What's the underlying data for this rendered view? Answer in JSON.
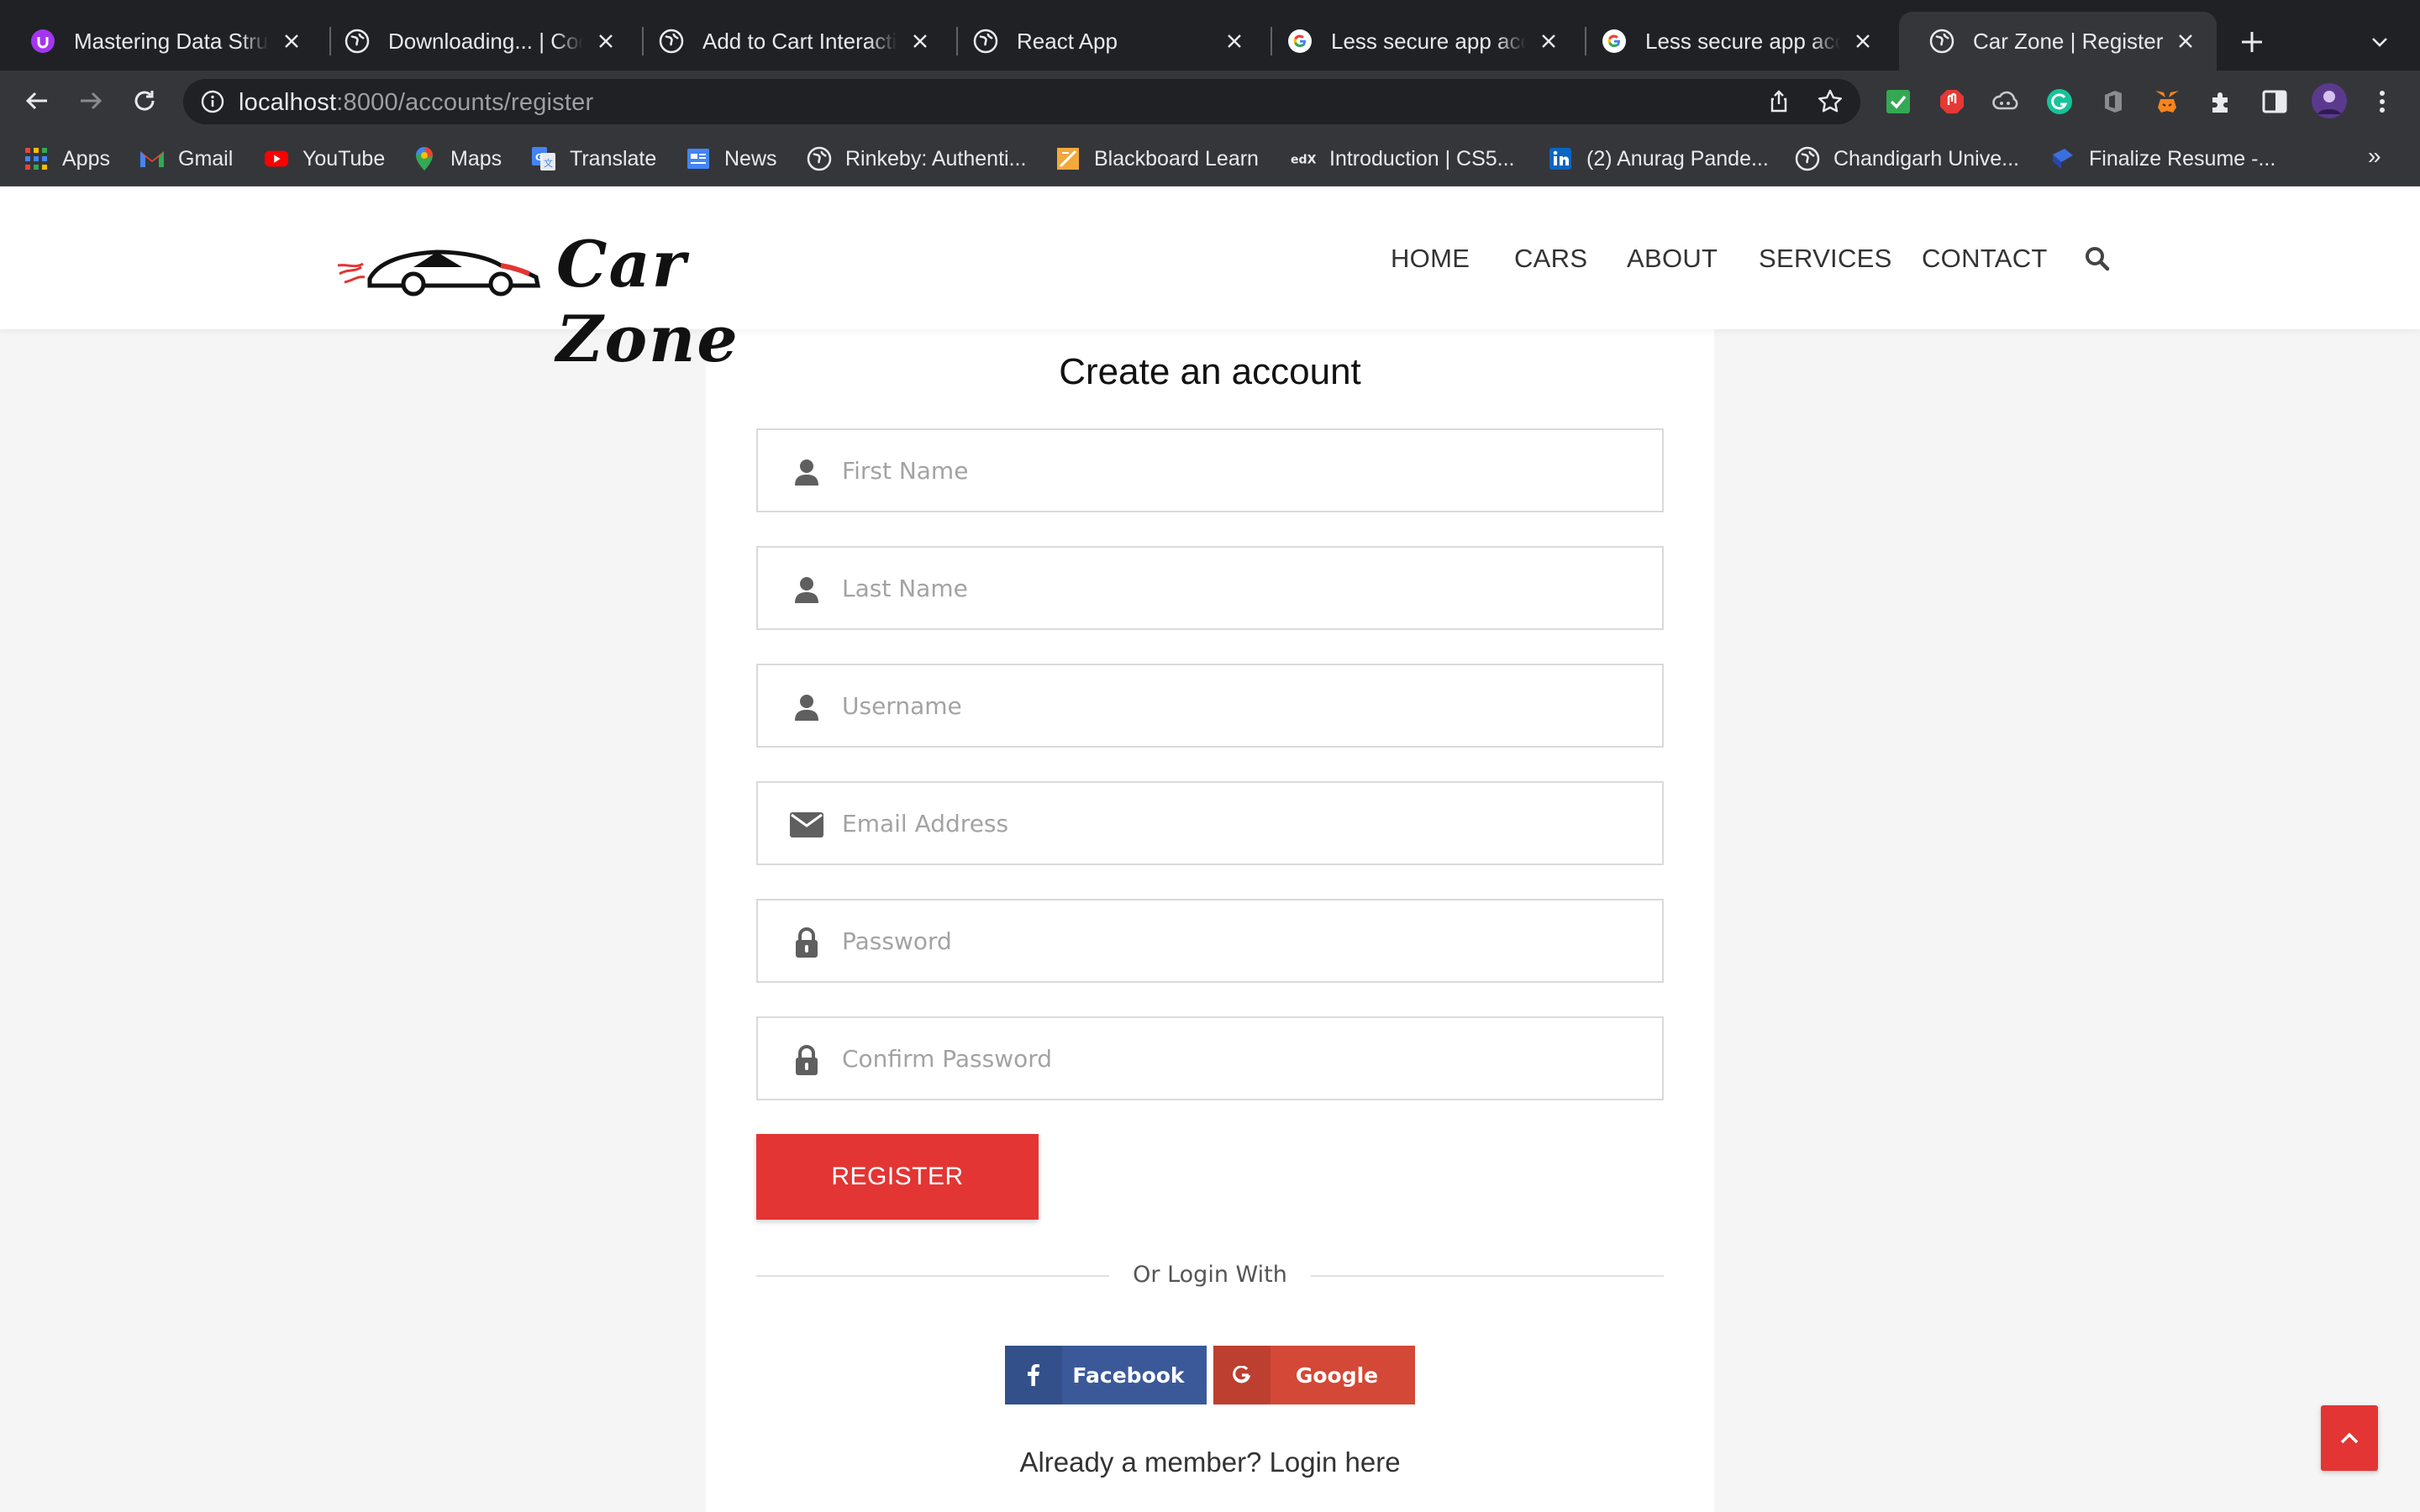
{
  "browser": {
    "tabs": [
      {
        "title": "Mastering Data Structures",
        "icon": "udemy-icon"
      },
      {
        "title": "Downloading... | Cody",
        "icon": "globe-icon"
      },
      {
        "title": "Add to Cart Interaction",
        "icon": "globe-icon"
      },
      {
        "title": "React App",
        "icon": "globe-icon"
      },
      {
        "title": "Less secure app access",
        "icon": "google-icon"
      },
      {
        "title": "Less secure app access",
        "icon": "google-icon"
      },
      {
        "title": "Car Zone | Register",
        "icon": "globe-icon",
        "active": true
      }
    ],
    "url_host": "localhost",
    "url_path": ":8000/accounts/register",
    "bookmarks": [
      {
        "label": "Apps",
        "icon": "apps-grid-icon"
      },
      {
        "label": "Gmail",
        "icon": "gmail-icon"
      },
      {
        "label": "YouTube",
        "icon": "youtube-icon"
      },
      {
        "label": "Maps",
        "icon": "maps-icon"
      },
      {
        "label": "Translate",
        "icon": "translate-icon"
      },
      {
        "label": "News",
        "icon": "news-icon"
      },
      {
        "label": "Rinkeby: Authenti...",
        "icon": "globe-icon"
      },
      {
        "label": "Blackboard Learn",
        "icon": "blackboard-icon"
      },
      {
        "label": "Introduction | CS5...",
        "icon": "edx-icon"
      },
      {
        "label": "(2) Anurag Pande...",
        "icon": "linkedin-icon"
      },
      {
        "label": "Chandigarh Unive...",
        "icon": "globe-icon"
      },
      {
        "label": "Finalize Resume -...",
        "icon": "resume-icon"
      }
    ],
    "bookmarks_overflow": "»"
  },
  "site": {
    "brand": "Car Zone",
    "nav": [
      "HOME",
      "CARS",
      "ABOUT",
      "SERVICES",
      "CONTACT"
    ],
    "accent_color": "#e23534"
  },
  "form": {
    "title": "Create an account",
    "fields": [
      {
        "placeholder": "First Name",
        "value": "",
        "icon": "user-icon"
      },
      {
        "placeholder": "Last Name",
        "value": "",
        "icon": "user-icon"
      },
      {
        "placeholder": "Username",
        "value": "",
        "icon": "user-icon"
      },
      {
        "placeholder": "Email Address",
        "value": "",
        "icon": "envelope-icon"
      },
      {
        "placeholder": "Password",
        "value": "",
        "icon": "lock-icon"
      },
      {
        "placeholder": "Confirm Password",
        "value": "",
        "icon": "lock-icon"
      }
    ],
    "register_label": "REGISTER",
    "or_text": "Or Login With",
    "facebook_label": "Facebook",
    "google_label": "Google",
    "already_member": "Already a member?  Login here"
  }
}
